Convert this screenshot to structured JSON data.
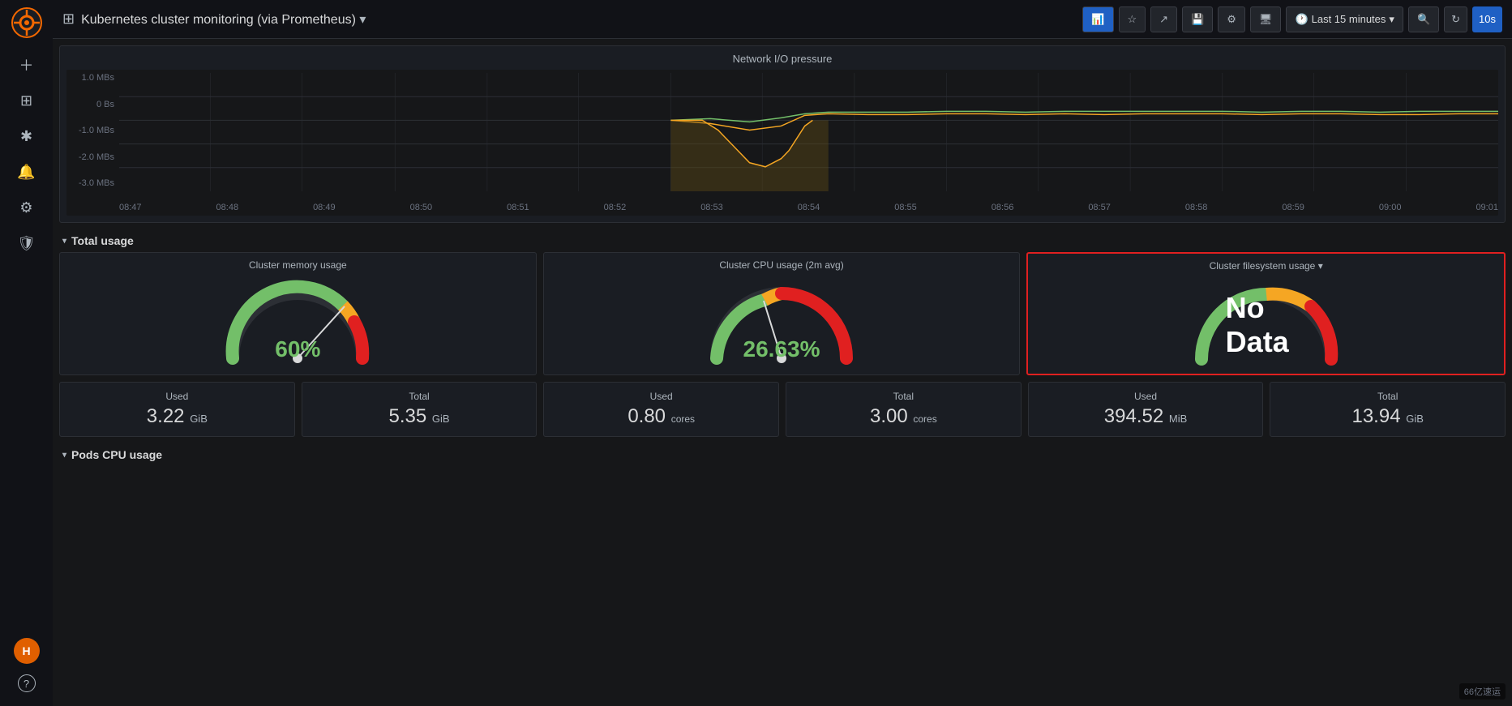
{
  "sidebar": {
    "logo_text": "🔥",
    "items": [
      {
        "id": "add",
        "icon": "+",
        "label": "add"
      },
      {
        "id": "dashboard",
        "icon": "⊞",
        "label": "dashboards"
      },
      {
        "id": "explore",
        "icon": "✱",
        "label": "explore"
      },
      {
        "id": "alerts",
        "icon": "🔔",
        "label": "alerting"
      },
      {
        "id": "settings",
        "icon": "⚙",
        "label": "settings"
      },
      {
        "id": "shield",
        "icon": "🛡",
        "label": "shield"
      }
    ],
    "bottom": [
      {
        "id": "avatar",
        "label": "H"
      },
      {
        "id": "help",
        "icon": "?",
        "label": "help"
      }
    ]
  },
  "topbar": {
    "grid_icon": "⊞",
    "title": "Kubernetes cluster monitoring (via Prometheus)",
    "title_dropdown": "▾",
    "buttons": [
      {
        "id": "visualizations",
        "label": "📊",
        "active": true
      },
      {
        "id": "star",
        "label": "☆"
      },
      {
        "id": "share",
        "label": "↗"
      },
      {
        "id": "save",
        "label": "💾"
      },
      {
        "id": "settings",
        "label": "⚙"
      },
      {
        "id": "monitor",
        "label": "🖥"
      }
    ],
    "time_range": "Last 15 minutes",
    "search_icon": "🔍",
    "refresh_icon": "↻",
    "refresh_interval": "10s"
  },
  "network_chart": {
    "title": "Network I/O pressure",
    "y_labels": [
      "1.0 MBs",
      "0 Bs",
      "-1.0 MBs",
      "-2.0 MBs",
      "-3.0 MBs"
    ],
    "x_labels": [
      "08:47",
      "08:48",
      "08:49",
      "08:50",
      "08:51",
      "08:52",
      "08:53",
      "08:54",
      "08:55",
      "08:56",
      "08:57",
      "08:58",
      "08:59",
      "09:00",
      "09:01"
    ]
  },
  "sections": {
    "total_usage": {
      "label": "Total usage",
      "chevron": "▾"
    },
    "pods_cpu": {
      "label": "Pods CPU usage",
      "chevron": "▾"
    }
  },
  "gauges": [
    {
      "id": "memory",
      "title": "Cluster memory usage",
      "value": "60%",
      "color": "#73bf69",
      "percent": 60
    },
    {
      "id": "cpu",
      "title": "Cluster CPU usage (2m avg)",
      "value": "26.63%",
      "color": "#73bf69",
      "percent": 26.63
    },
    {
      "id": "filesystem",
      "title": "Cluster filesystem usage",
      "title_dropdown": "▾",
      "value": "No Data",
      "color": "#fff",
      "percent": 0,
      "no_data": true,
      "selected": true
    }
  ],
  "stats": [
    [
      {
        "id": "mem-used",
        "label": "Used",
        "value": "3.22",
        "unit": "GiB"
      },
      {
        "id": "mem-total",
        "label": "Total",
        "value": "5.35",
        "unit": "GiB"
      }
    ],
    [
      {
        "id": "cpu-used",
        "label": "Used",
        "value": "0.80",
        "unit": "cores"
      },
      {
        "id": "cpu-total",
        "label": "Total",
        "value": "3.00",
        "unit": "cores"
      }
    ],
    [
      {
        "id": "fs-used",
        "label": "Used",
        "value": "394.52",
        "unit": "MiB"
      },
      {
        "id": "fs-total",
        "label": "Total",
        "value": "13.94",
        "unit": "GiB"
      }
    ]
  ],
  "watermark": "66亿速运"
}
